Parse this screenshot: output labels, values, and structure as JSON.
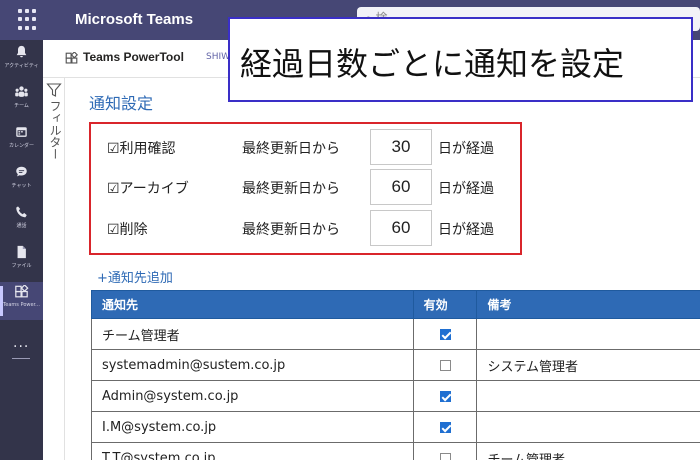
{
  "topbar": {
    "app_title": "Microsoft Teams",
    "search_hint": "⌕ 検"
  },
  "rail": {
    "items": [
      {
        "label": "アクティビティ",
        "icon": "bell-icon"
      },
      {
        "label": "チーム",
        "icon": "teams-icon"
      },
      {
        "label": "カレンダー",
        "icon": "calendar-icon"
      },
      {
        "label": "チャット",
        "icon": "chat-icon"
      },
      {
        "label": "通話",
        "icon": "phone-icon"
      },
      {
        "label": "ファイル",
        "icon": "file-icon"
      },
      {
        "label": "Teams Power...",
        "icon": "app-icon"
      }
    ],
    "more": "..."
  },
  "app_header": {
    "app_name": "Teams PowerTool",
    "tab": "SHIW"
  },
  "filter": {
    "label": "フィルター"
  },
  "main": {
    "section_title": "通知設定",
    "settings": [
      {
        "label": "☑利用確認",
        "prefix": "最終更新日から",
        "days": "30",
        "suffix": "日が経過"
      },
      {
        "label": "☑アーカイブ",
        "prefix": "最終更新日から",
        "days": "60",
        "suffix": "日が経過"
      },
      {
        "label": "☑削除",
        "prefix": "最終更新日から",
        "days": "60",
        "suffix": "日が経過"
      }
    ],
    "add_link": "+通知先追加",
    "table": {
      "headers": [
        "通知先",
        "有効",
        "備考"
      ],
      "rows": [
        {
          "target": "チーム管理者",
          "enabled": true,
          "note": ""
        },
        {
          "target": "systemadmin@sustem.co.jp",
          "enabled": false,
          "note": "システム管理者"
        },
        {
          "target": "Admin@system.co.jp",
          "enabled": true,
          "note": ""
        },
        {
          "target": "I.M@system.co.jp",
          "enabled": true,
          "note": ""
        },
        {
          "target": "T.T@system.co.jp",
          "enabled": false,
          "note": "チーム管理者"
        }
      ]
    }
  },
  "banner": {
    "text": "経過日数ごとに通知を設定"
  },
  "colors": {
    "teams_purple": "#464775",
    "accent_blue": "#2e6ab5",
    "highlight_red": "#d9252b",
    "banner_border": "#3a2fc7"
  }
}
